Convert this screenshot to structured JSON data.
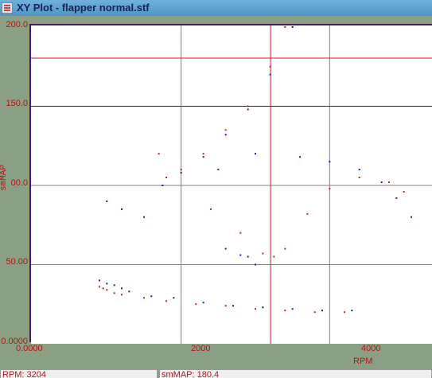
{
  "window": {
    "title": "XY Plot - flapper normal.stf",
    "icon": "list-icon"
  },
  "plot": {
    "colors": {
      "background": "#ffffff",
      "grid": "#808080",
      "frame": "#4a1a6a",
      "series_red": "#cc2020",
      "series_blue": "#1020b0",
      "line_red": "#d02020",
      "line_blue": "#1a1aa0"
    }
  },
  "chart_data": {
    "type": "scatter",
    "xlabel": "RPM",
    "ylabel": "smMAP",
    "xlim": [
      0,
      5400
    ],
    "ylim": [
      0,
      200
    ],
    "x_tick_labels": [
      "0.0000",
      "2000",
      "4000"
    ],
    "y_tick_labels": [
      "0.0000",
      "50.00",
      "00.0",
      "150.0",
      "200.0"
    ],
    "x_ticks": [
      0,
      2000,
      4000
    ],
    "y_ticks": [
      0,
      50,
      100,
      150,
      200
    ],
    "grid": true,
    "reference_lines": [
      {
        "orientation": "horizontal",
        "value": 180.4,
        "color": "red"
      },
      {
        "orientation": "vertical",
        "value": 3204,
        "color": "red"
      },
      {
        "orientation": "horizontal",
        "value": 150,
        "color": "blue"
      }
    ],
    "series": [
      {
        "color": "red",
        "points": [
          [
            900,
            36
          ],
          [
            950,
            35
          ],
          [
            1000,
            34
          ],
          [
            1100,
            32
          ],
          [
            1200,
            31
          ],
          [
            1500,
            29
          ],
          [
            1800,
            27
          ],
          [
            2200,
            25
          ],
          [
            2600,
            24
          ],
          [
            3000,
            22
          ],
          [
            3400,
            21
          ],
          [
            3800,
            20
          ],
          [
            4200,
            20
          ],
          [
            1800,
            105
          ],
          [
            2000,
            110
          ],
          [
            2300,
            120
          ],
          [
            2600,
            135
          ],
          [
            2900,
            150
          ],
          [
            3200,
            175
          ],
          [
            3400,
            200
          ],
          [
            1700,
            120
          ],
          [
            2400,
            85
          ],
          [
            2800,
            70
          ],
          [
            3100,
            57
          ],
          [
            3250,
            55
          ],
          [
            3400,
            60
          ],
          [
            3700,
            82
          ],
          [
            4000,
            98
          ],
          [
            4400,
            105
          ],
          [
            4800,
            102
          ],
          [
            5000,
            96
          ]
        ]
      },
      {
        "color": "blue",
        "points": [
          [
            900,
            40
          ],
          [
            1000,
            38
          ],
          [
            1100,
            37
          ],
          [
            1200,
            35
          ],
          [
            1300,
            33
          ],
          [
            1600,
            30
          ],
          [
            1900,
            29
          ],
          [
            2300,
            26
          ],
          [
            2700,
            24
          ],
          [
            3100,
            23
          ],
          [
            3500,
            22
          ],
          [
            3900,
            21
          ],
          [
            4300,
            21
          ],
          [
            1750,
            100
          ],
          [
            2000,
            108
          ],
          [
            2300,
            118
          ],
          [
            2600,
            132
          ],
          [
            2900,
            148
          ],
          [
            3200,
            170
          ],
          [
            3500,
            200
          ],
          [
            1000,
            90
          ],
          [
            1200,
            85
          ],
          [
            1500,
            80
          ],
          [
            2500,
            110
          ],
          [
            3000,
            120
          ],
          [
            3600,
            118
          ],
          [
            4000,
            115
          ],
          [
            4400,
            110
          ],
          [
            4700,
            102
          ],
          [
            4900,
            92
          ],
          [
            5100,
            80
          ],
          [
            2600,
            60
          ],
          [
            2800,
            56
          ],
          [
            2900,
            55
          ],
          [
            3000,
            50
          ]
        ]
      }
    ]
  },
  "status": {
    "rpm": "RPM: 3204",
    "smmap": "smMAP: 180.4"
  }
}
